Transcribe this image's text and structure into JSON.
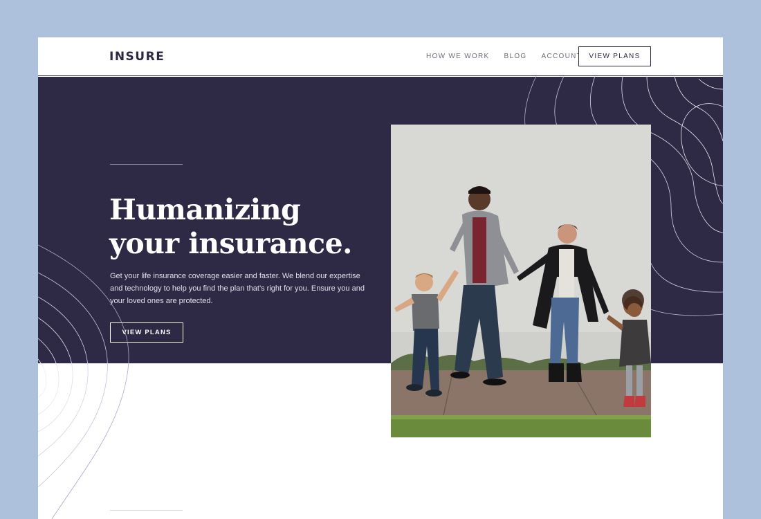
{
  "brand": {
    "logo": "INSURE"
  },
  "nav": {
    "items": [
      {
        "label": "HOW WE WORK"
      },
      {
        "label": "BLOG"
      },
      {
        "label": "ACCOUNT"
      }
    ],
    "cta": "VIEW PLANS"
  },
  "hero": {
    "headline_line1": "Humanizing",
    "headline_line2": "your insurance.",
    "body": "Get your life insurance coverage easier and faster. We blend our expertise and technology to help you find the plan that’s right for you. Ensure you and your loved ones are protected.",
    "cta": "VIEW PLANS"
  },
  "colors": {
    "outer_background": "#adc1dc",
    "hero_background": "#2e2944",
    "brand_text": "#2d2640"
  }
}
